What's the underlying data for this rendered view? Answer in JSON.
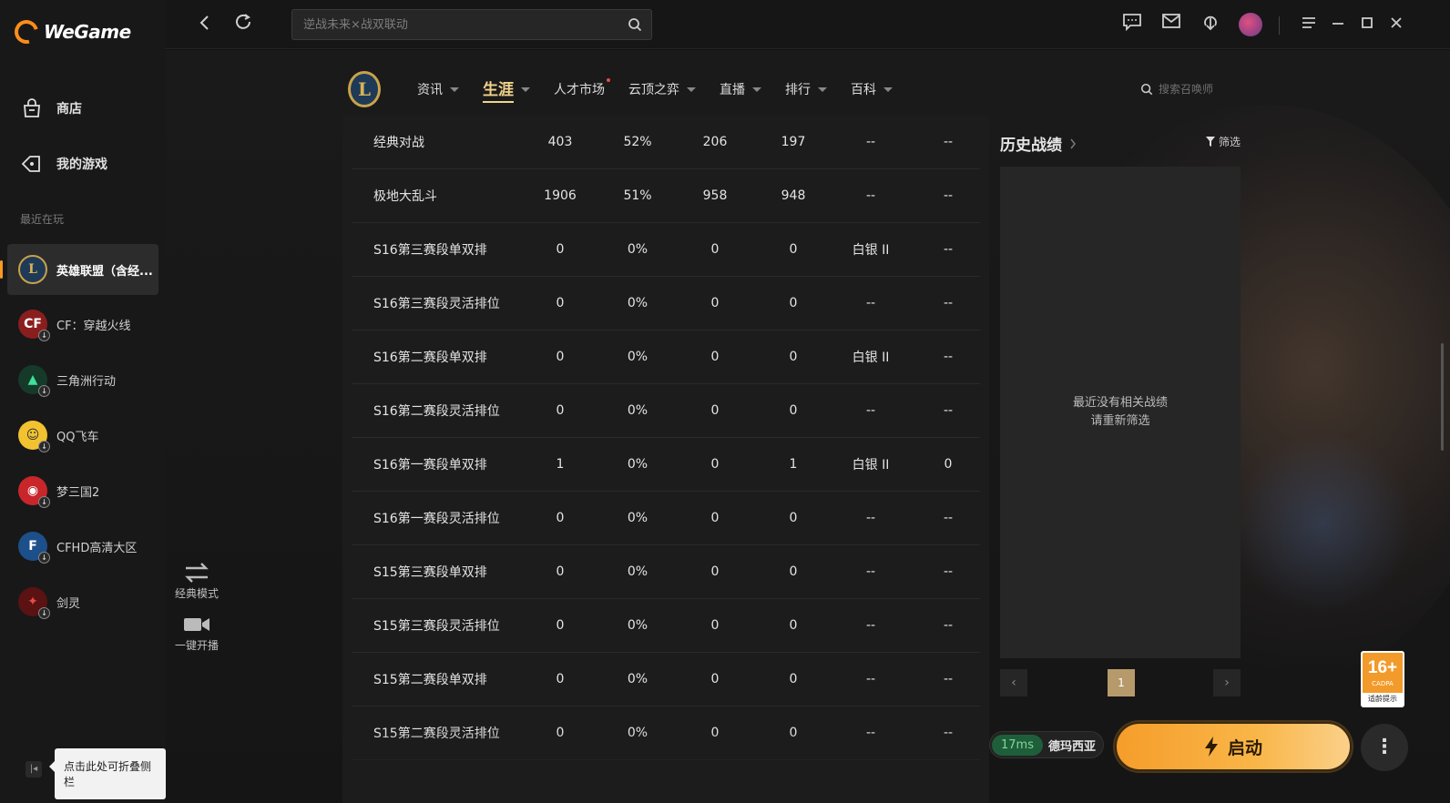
{
  "app": {
    "brand": "WeGame"
  },
  "sidebar": {
    "nav": [
      {
        "label": "商店",
        "icon": "shop-bag-icon"
      },
      {
        "label": "我的游戏",
        "icon": "gamepad-tag-icon"
      }
    ],
    "recent_label": "最近在玩",
    "games": [
      {
        "label": "英雄联盟（含经...",
        "icon": "lol-icon",
        "active": true
      },
      {
        "label": "CF：穿越火线",
        "icon": "cf-icon"
      },
      {
        "label": "三角洲行动",
        "icon": "delta-force-icon"
      },
      {
        "label": "QQ飞车",
        "icon": "qq-speed-icon"
      },
      {
        "label": "梦三国2",
        "icon": "meng-sanguo-icon"
      },
      {
        "label": "CFHD高清大区",
        "icon": "cfhd-icon"
      },
      {
        "label": "剑灵",
        "icon": "blade-soul-icon"
      }
    ],
    "collapse_tooltip": "点击此处可折叠侧栏"
  },
  "topbar": {
    "search_placeholder": "逆战未来×战双联动"
  },
  "gamenav": {
    "tabs": [
      {
        "label": "资讯",
        "caret": true
      },
      {
        "label": "生涯",
        "caret": true,
        "active": true
      },
      {
        "label": "人才市场",
        "caret": false,
        "dot": true
      },
      {
        "label": "云顶之弈",
        "caret": true
      },
      {
        "label": "直播",
        "caret": true
      },
      {
        "label": "排行",
        "caret": true
      },
      {
        "label": "百科",
        "caret": true
      }
    ],
    "summoner_search_placeholder": "搜索召唤师"
  },
  "tools": [
    {
      "label": "经典模式",
      "icon": "swap-arrows-icon"
    },
    {
      "label": "一键开播",
      "icon": "video-camera-icon"
    }
  ],
  "stats_rows": [
    [
      "经典对战",
      "403",
      "52%",
      "206",
      "197",
      "--",
      "--"
    ],
    [
      "极地大乱斗",
      "1906",
      "51%",
      "958",
      "948",
      "--",
      "--"
    ],
    [
      "S16第三赛段单双排",
      "0",
      "0%",
      "0",
      "0",
      "白银 II",
      "--"
    ],
    [
      "S16第三赛段灵活排位",
      "0",
      "0%",
      "0",
      "0",
      "--",
      "--"
    ],
    [
      "S16第二赛段单双排",
      "0",
      "0%",
      "0",
      "0",
      "白银 II",
      "--"
    ],
    [
      "S16第二赛段灵活排位",
      "0",
      "0%",
      "0",
      "0",
      "--",
      "--"
    ],
    [
      "S16第一赛段单双排",
      "1",
      "0%",
      "0",
      "1",
      "白银 II",
      "0"
    ],
    [
      "S16第一赛段灵活排位",
      "0",
      "0%",
      "0",
      "0",
      "--",
      "--"
    ],
    [
      "S15第三赛段单双排",
      "0",
      "0%",
      "0",
      "0",
      "--",
      "--"
    ],
    [
      "S15第三赛段灵活排位",
      "0",
      "0%",
      "0",
      "0",
      "--",
      "--"
    ],
    [
      "S15第二赛段单双排",
      "0",
      "0%",
      "0",
      "0",
      "--",
      "--"
    ],
    [
      "S15第二赛段灵活排位",
      "0",
      "0%",
      "0",
      "0",
      "--",
      "--"
    ]
  ],
  "history": {
    "title": "历史战绩",
    "filter_label": "筛选",
    "empty_line1": "最近没有相关战绩",
    "empty_line2": "请重新筛选",
    "current_page": "1"
  },
  "launch": {
    "ping": "17ms",
    "server": "德玛西亚",
    "button_label": "启动",
    "more_label": "⋮"
  },
  "age_rating": {
    "value": "16+",
    "small": "CADPA",
    "caption": "适龄提示"
  }
}
